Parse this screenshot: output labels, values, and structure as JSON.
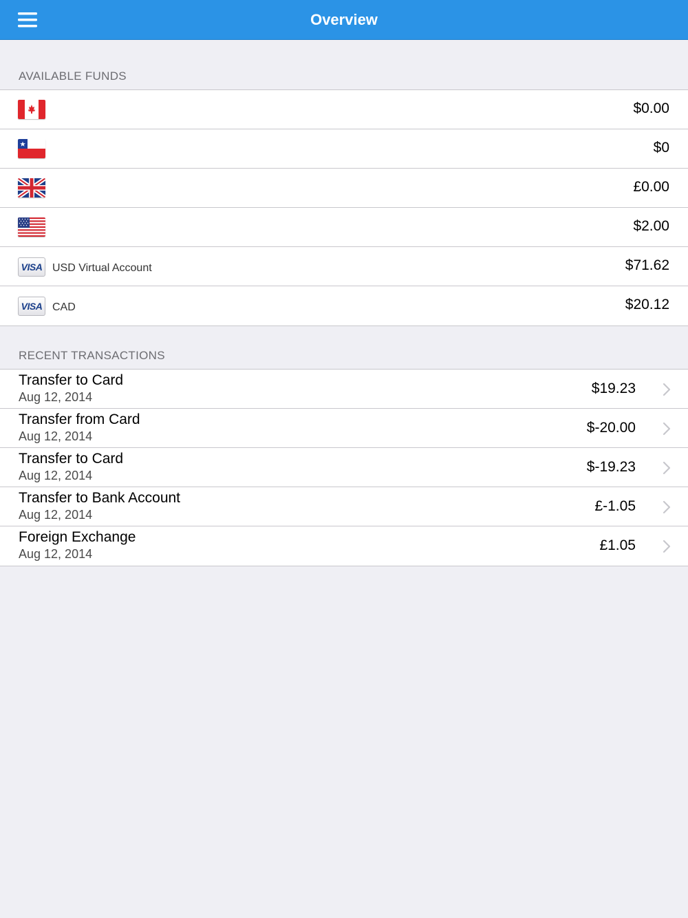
{
  "navbar": {
    "title": "Overview"
  },
  "funds": {
    "header": "AVAILABLE FUNDS",
    "items": [
      {
        "icon": "canada-flag-icon",
        "label": "",
        "amount": "$0.00"
      },
      {
        "icon": "chile-flag-icon",
        "label": "",
        "amount": "$0"
      },
      {
        "icon": "uk-flag-icon",
        "label": "",
        "amount": "£0.00"
      },
      {
        "icon": "us-flag-icon",
        "label": "",
        "amount": "$2.00"
      },
      {
        "icon": "visa-card-icon",
        "icon_text": "VISA",
        "label": "USD Virtual Account",
        "amount": "$71.62"
      },
      {
        "icon": "visa-card-icon",
        "icon_text": "VISA",
        "label": "CAD",
        "amount": "$20.12"
      }
    ]
  },
  "transactions": {
    "header": "RECENT TRANSACTIONS",
    "items": [
      {
        "title": "Transfer to Card",
        "date": "Aug 12, 2014",
        "amount": "$19.23"
      },
      {
        "title": "Transfer from Card",
        "date": "Aug 12, 2014",
        "amount": "$-20.00"
      },
      {
        "title": "Transfer to Card",
        "date": "Aug 12, 2014",
        "amount": "$-19.23"
      },
      {
        "title": "Transfer to Bank Account",
        "date": "Aug 12, 2014",
        "amount": "£-1.05"
      },
      {
        "title": "Foreign Exchange",
        "date": "Aug 12, 2014",
        "amount": "£1.05"
      }
    ]
  },
  "colors": {
    "navbar": "#2b93e6",
    "background": "#efeff4",
    "separator": "#c8c7cc",
    "section_header_text": "#6d6d72"
  }
}
